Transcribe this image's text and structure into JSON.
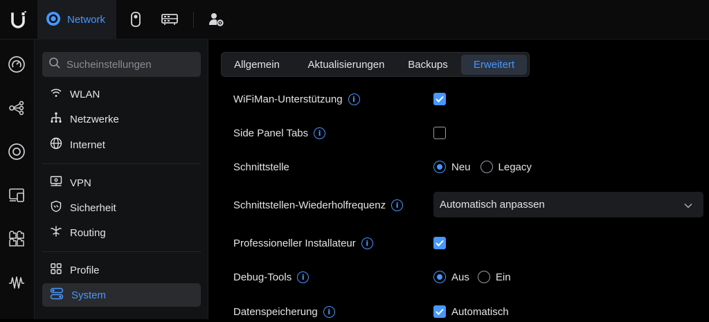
{
  "topbar": {
    "app_tab_label": "Network",
    "icons": [
      "ubiquiti-logo",
      "network-app-icon",
      "protect-camera-icon",
      "gateway-device-icon",
      "admin-settings-icon"
    ]
  },
  "rail": {
    "icons": [
      "dashboard-icon",
      "topology-icon",
      "devices-icon",
      "clients-icon",
      "statistics-icon",
      "insights-icon"
    ]
  },
  "search": {
    "placeholder": "Sucheinstellungen"
  },
  "sidebar": {
    "items": [
      {
        "label": "WLAN",
        "icon": "wifi-icon"
      },
      {
        "label": "Netzwerke",
        "icon": "network-tree-icon"
      },
      {
        "label": "Internet",
        "icon": "globe-icon"
      },
      {
        "label": "VPN",
        "icon": "vpn-monitor-icon"
      },
      {
        "label": "Sicherheit",
        "icon": "shield-icon"
      },
      {
        "label": "Routing",
        "icon": "routing-icon"
      },
      {
        "label": "Profile",
        "icon": "profiles-icon"
      },
      {
        "label": "System",
        "icon": "system-toggle-icon"
      }
    ],
    "active": "System"
  },
  "tabs": {
    "items": [
      "Allgemein",
      "Aktualisierungen",
      "Backups",
      "Erweitert"
    ],
    "active": "Erweitert"
  },
  "settings": {
    "wifiman": {
      "label": "WiFiMan-Unterstützung",
      "checked": true
    },
    "side_panel": {
      "label": "Side Panel Tabs",
      "checked": false
    },
    "interface": {
      "label": "Schnittstelle",
      "options": [
        "Neu",
        "Legacy"
      ],
      "selected": "Neu"
    },
    "refresh": {
      "label": "Schnittstellen-Wiederholfrequenz",
      "value": "Automatisch anpassen"
    },
    "pro_installer": {
      "label": "Professioneller Installateur",
      "checked": true
    },
    "debug": {
      "label": "Debug-Tools",
      "options": [
        "Aus",
        "Ein"
      ],
      "selected": "Aus"
    },
    "storage": {
      "label": "Datenspeicherung",
      "checkbox_label": "Automatisch",
      "checked": true
    }
  },
  "colors": {
    "accent": "#4797ff",
    "background": "#000000",
    "panel": "#121315"
  }
}
